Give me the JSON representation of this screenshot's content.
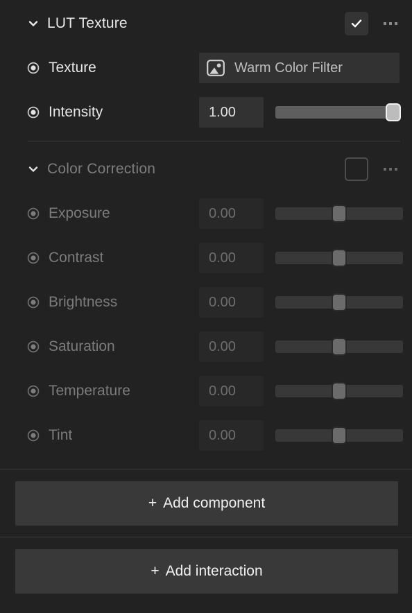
{
  "panel": {
    "background_color": "#222222"
  },
  "sections": [
    {
      "id": "lut-texture",
      "title": "LUT Texture",
      "enabled": true,
      "expanded": true,
      "chevron_icon": "chevron-down-icon",
      "checkbox_state": "checked",
      "overflow_icon": "more-options-icon",
      "properties": [
        {
          "id": "texture",
          "label": "Texture",
          "keyframe_icon": "keyframe-indicator-icon",
          "control": "asset-picker",
          "asset_icon": "image-asset-icon",
          "asset_name": "Warm Color Filter"
        },
        {
          "id": "intensity",
          "label": "Intensity",
          "keyframe_icon": "keyframe-indicator-icon",
          "control": "slider",
          "value": "1.00",
          "slider_percent": 100
        }
      ]
    },
    {
      "id": "color-correction",
      "title": "Color Correction",
      "enabled": false,
      "expanded": true,
      "chevron_icon": "chevron-down-icon",
      "checkbox_state": "unchecked",
      "overflow_icon": "more-options-icon",
      "properties": [
        {
          "id": "exposure",
          "label": "Exposure",
          "keyframe_icon": "keyframe-indicator-icon",
          "control": "slider",
          "value": "0.00",
          "slider_percent": 50
        },
        {
          "id": "contrast",
          "label": "Contrast",
          "keyframe_icon": "keyframe-indicator-icon",
          "control": "slider",
          "value": "0.00",
          "slider_percent": 50
        },
        {
          "id": "brightness",
          "label": "Brightness",
          "keyframe_icon": "keyframe-indicator-icon",
          "control": "slider",
          "value": "0.00",
          "slider_percent": 50
        },
        {
          "id": "saturation",
          "label": "Saturation",
          "keyframe_icon": "keyframe-indicator-icon",
          "control": "slider",
          "value": "0.00",
          "slider_percent": 50
        },
        {
          "id": "temperature",
          "label": "Temperature",
          "keyframe_icon": "keyframe-indicator-icon",
          "control": "slider",
          "value": "0.00",
          "slider_percent": 50
        },
        {
          "id": "tint",
          "label": "Tint",
          "keyframe_icon": "keyframe-indicator-icon",
          "control": "slider",
          "value": "0.00",
          "slider_percent": 50
        }
      ]
    }
  ],
  "footer": {
    "add_component_label": "Add component",
    "add_interaction_label": "Add interaction",
    "plus_glyph": "+"
  }
}
